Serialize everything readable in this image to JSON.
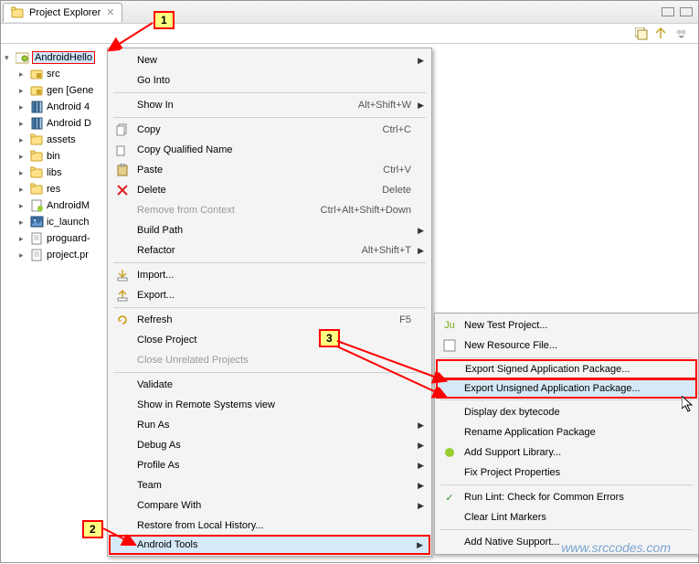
{
  "tab": {
    "title": "Project Explorer"
  },
  "tree": {
    "project": "AndroidHello",
    "items": [
      {
        "kind": "pkg",
        "label": "src"
      },
      {
        "kind": "pkg",
        "label": "gen [Gene"
      },
      {
        "kind": "lib",
        "label": "Android 4"
      },
      {
        "kind": "lib",
        "label": "Android D"
      },
      {
        "kind": "folder",
        "label": "assets"
      },
      {
        "kind": "folder",
        "label": "bin"
      },
      {
        "kind": "folder",
        "label": "libs"
      },
      {
        "kind": "folder",
        "label": "res"
      },
      {
        "kind": "xml",
        "label": "AndroidM"
      },
      {
        "kind": "img",
        "label": "ic_launch"
      },
      {
        "kind": "txt",
        "label": "proguard-"
      },
      {
        "kind": "txt",
        "label": "project.pr"
      }
    ]
  },
  "menu1": {
    "new": "New",
    "go_into": "Go Into",
    "show_in": "Show In",
    "show_in_sc": "Alt+Shift+W",
    "copy": "Copy",
    "copy_sc": "Ctrl+C",
    "copy_qn": "Copy Qualified Name",
    "paste": "Paste",
    "paste_sc": "Ctrl+V",
    "delete": "Delete",
    "delete_sc": "Delete",
    "remove_ctx": "Remove from Context",
    "remove_ctx_sc": "Ctrl+Alt+Shift+Down",
    "build_path": "Build Path",
    "refactor": "Refactor",
    "refactor_sc": "Alt+Shift+T",
    "import": "Import...",
    "export": "Export...",
    "refresh": "Refresh",
    "refresh_sc": "F5",
    "close_proj": "Close Project",
    "close_unrel": "Close Unrelated Projects",
    "validate": "Validate",
    "show_remote": "Show in Remote Systems view",
    "run_as": "Run As",
    "debug_as": "Debug As",
    "profile_as": "Profile As",
    "team": "Team",
    "compare": "Compare With",
    "restore": "Restore from Local History...",
    "android_tools": "Android Tools"
  },
  "menu2": {
    "new_test": "New Test Project...",
    "new_res": "New Resource File...",
    "export_signed": "Export Signed Application Package...",
    "export_unsigned": "Export Unsigned Application Package...",
    "display_dex": "Display dex bytecode",
    "rename_pkg": "Rename Application Package",
    "add_support": "Add Support Library...",
    "fix_props": "Fix Project Properties",
    "run_lint": "Run Lint: Check for Common Errors",
    "clear_lint": "Clear Lint Markers",
    "add_native": "Add Native Support..."
  },
  "callouts": {
    "c1": "1",
    "c2": "2",
    "c3": "3"
  },
  "watermark": "www.srccodes.com"
}
